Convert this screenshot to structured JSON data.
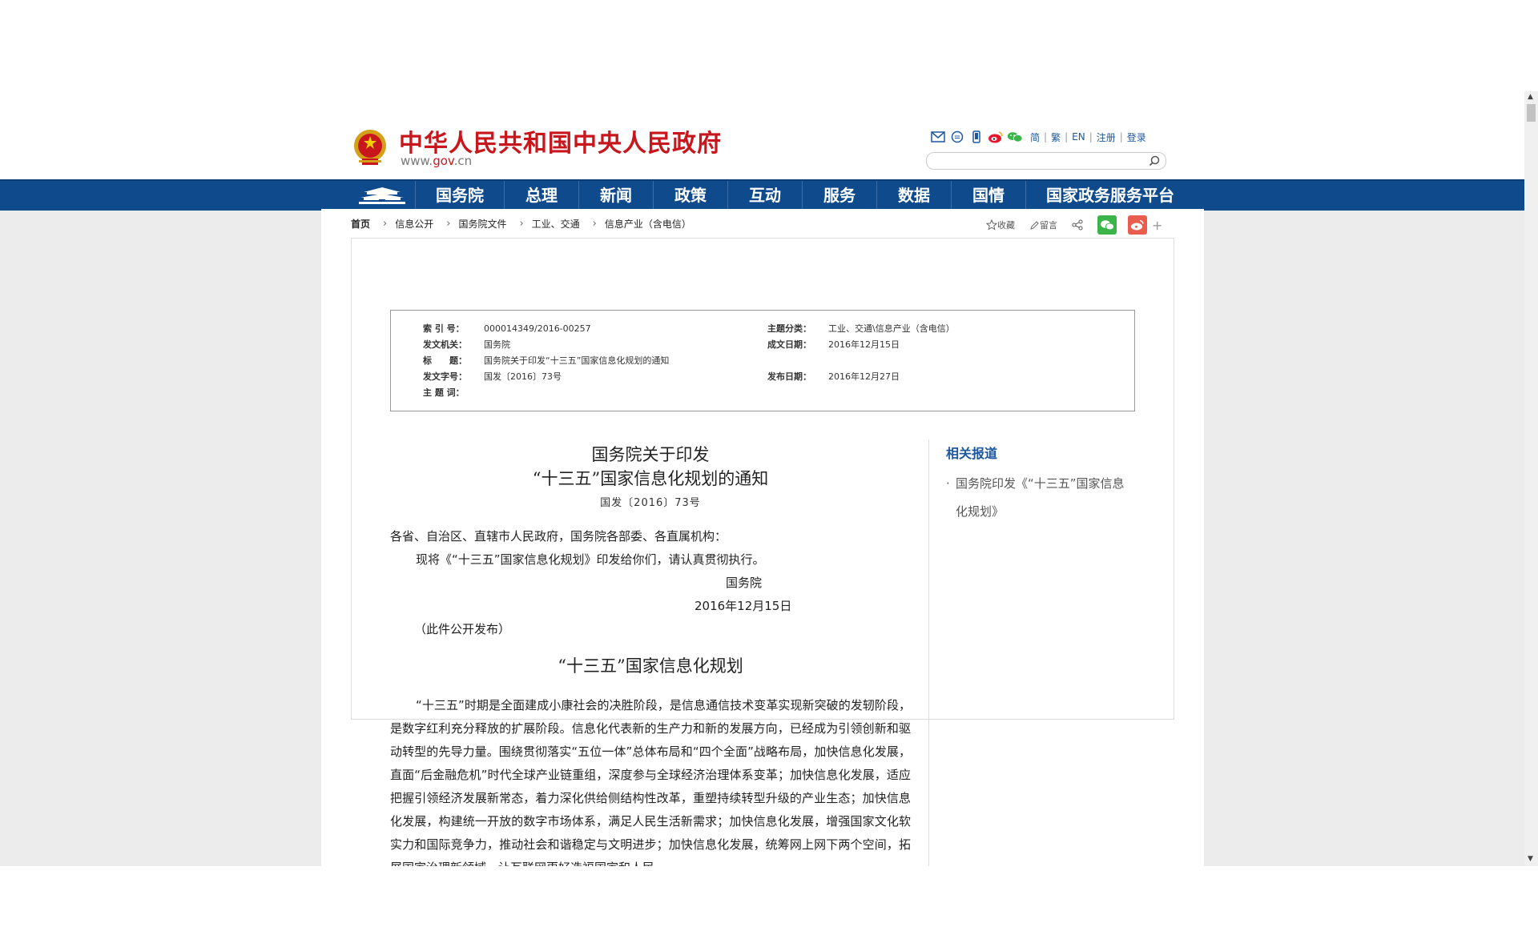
{
  "header": {
    "site_title": "中华人民共和国中央人民政府",
    "url_prefix": "www.",
    "url_gov": "gov",
    "url_suffix": ".cn",
    "links": [
      "简",
      "繁",
      "EN",
      "注册",
      "登录"
    ],
    "search_placeholder": ""
  },
  "nav": {
    "items": [
      "国务院",
      "总理",
      "新闻",
      "政策",
      "互动",
      "服务",
      "数据",
      "国情",
      "国家政务服务平台"
    ]
  },
  "breadcrumb": [
    "首页",
    "信息公开",
    "国务院文件",
    "工业、交通",
    "信息产业（含电信）"
  ],
  "share": {
    "favorite": "收藏",
    "comment": "留言",
    "plus": "+"
  },
  "meta": {
    "index_label": "索 引 号：",
    "index_value": "000014349/2016-00257",
    "topic_label": "主题分类：",
    "topic_value": "工业、交通\\信息产业（含电信）",
    "issuer_label": "发文机关：",
    "issuer_value": "国务院",
    "written_label": "成文日期：",
    "written_value": "2016年12月15日",
    "title_label": "标　　题：",
    "title_value": "国务院关于印发“十三五”国家信息化规划的通知",
    "docno_label": "发文字号：",
    "docno_value": "国发〔2016〕73号",
    "published_label": "发布日期：",
    "published_value": "2016年12月27日",
    "keywords_label": "主 题 词："
  },
  "article": {
    "title_line1": "国务院关于印发",
    "title_line2": "“十三五”国家信息化规划的通知",
    "doc_number": "国发〔2016〕73号",
    "addressee": "各省、自治区、直辖市人民政府，国务院各部委、各直属机构：",
    "body": "现将《“十三五”国家信息化规划》印发给你们，请认真贯彻执行。",
    "signer": "国务院",
    "sign_date": "2016年12月15日",
    "note": "（此件公开发布）",
    "plan_title": "“十三五”国家信息化规划",
    "plan_para": "“十三五”时期是全面建成小康社会的决胜阶段，是信息通信技术变革实现新突破的发轫阶段，是数字红利充分释放的扩展阶段。信息化代表新的生产力和新的发展方向，已经成为引领创新和驱动转型的先导力量。围绕贯彻落实“五位一体”总体布局和“四个全面”战略布局，加快信息化发展，直面“后金融危机”时代全球产业链重组，深度参与全球经济治理体系变革；加快信息化发展，适应把握引领经济发展新常态，着力深化供给侧结构性改革，重塑持续转型升级的产业生态；加快信息化发展，构建统一开放的数字市场体系，满足人民生活新需求；加快信息化发展，增强国家文化软实力和国际竞争力，推动社会和谐稳定与文明进步；加快信息化发展，统筹网上网下两个空间，拓展国家治理新领域，让互联网更好造福国家和人民。"
  },
  "sidebar": {
    "title": "相关报道",
    "items": [
      "国务院印发《“十三五”国家信息化规划》"
    ]
  },
  "colors": {
    "brand_red": "#c8161d",
    "nav_blue": "#0e4a8c",
    "link_blue": "#1d57a0"
  }
}
